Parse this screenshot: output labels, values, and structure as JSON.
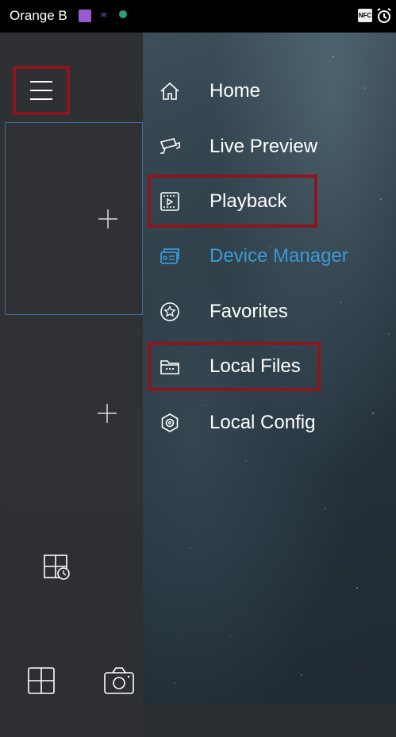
{
  "status_bar": {
    "carrier": "Orange B",
    "nfc_label": "NFC"
  },
  "drawer": {
    "items": [
      {
        "label": "Home",
        "icon": "home-icon",
        "active": false
      },
      {
        "label": "Live Preview",
        "icon": "camera-icon",
        "active": false
      },
      {
        "label": "Playback",
        "icon": "playback-icon",
        "active": false
      },
      {
        "label": "Device Manager",
        "icon": "device-manager-icon",
        "active": true
      },
      {
        "label": "Favorites",
        "icon": "favorites-icon",
        "active": false
      },
      {
        "label": "Local Files",
        "icon": "folder-icon",
        "active": false
      },
      {
        "label": "Local Config",
        "icon": "settings-icon",
        "active": false
      }
    ],
    "active_color": "#3a9ad9"
  },
  "annotation_color": "#8b1620"
}
